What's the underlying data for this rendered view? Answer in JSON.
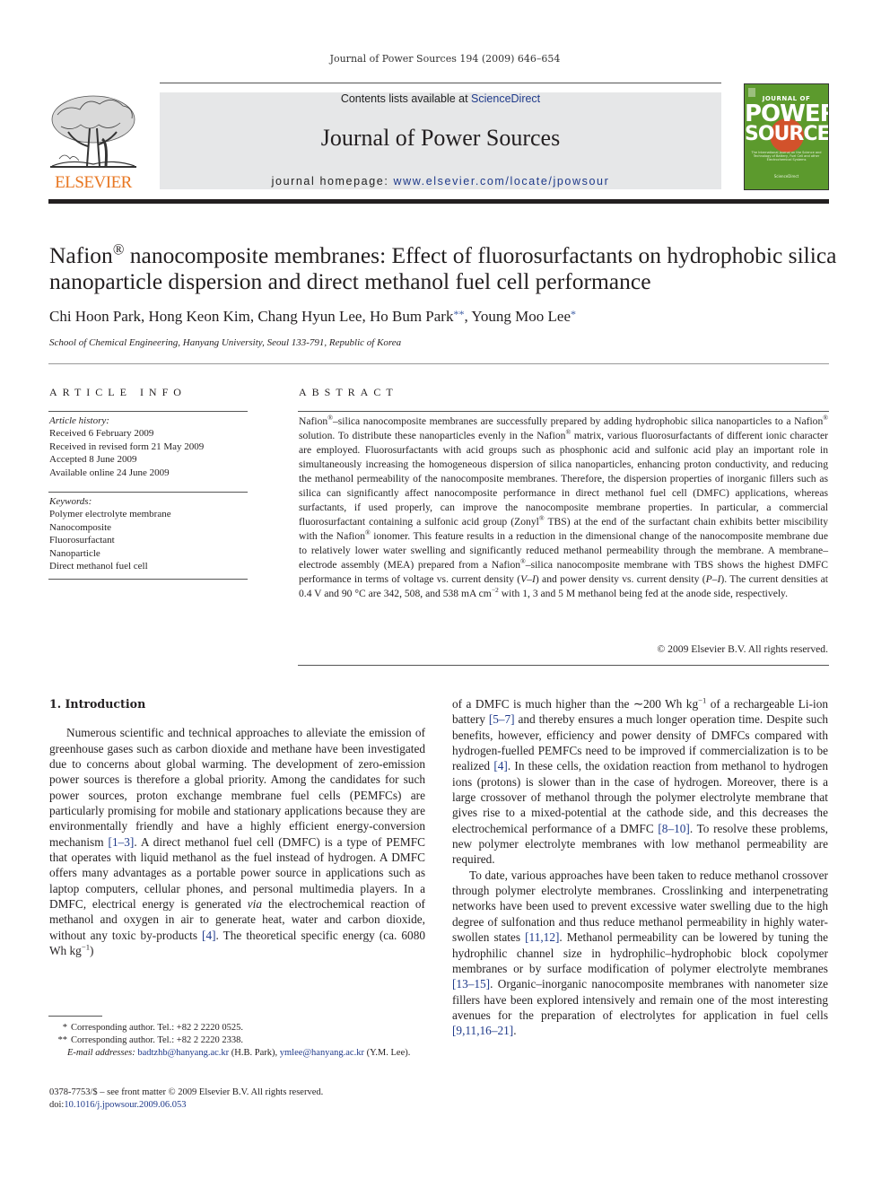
{
  "running_header": "Journal of Power Sources 194 (2009) 646–654",
  "masthead": {
    "publisher_logo_text": "ELSEVIER",
    "contents_prefix": "Contents lists available at ",
    "contents_link": "ScienceDirect",
    "journal_title": "Journal of Power Sources",
    "homepage_prefix": "journal homepage: ",
    "homepage_link": "www.elsevier.com/locate/jpowsour",
    "cover": {
      "line1": "JOURNAL OF",
      "line2": "POWER",
      "line3": "SOURCES",
      "subtitle": "The International Journal on the Science and Technology of Battery, Fuel Cell and other Electrochemical Systems",
      "publisher": "ScienceDirect"
    },
    "colors": {
      "elsevier_orange": "#e87722",
      "cover_green": "#5c9a2d",
      "cover_sun": "#d2522b",
      "link_blue": "#1f3a8a",
      "masthead_gray": "#e6e7e8"
    }
  },
  "article": {
    "title_part1": "Nafion",
    "title_reg": "®",
    "title_part2": " nanocomposite membranes: Effect of fluorosurfactants on hydrophobic silica nanoparticle dispersion and direct methanol fuel cell performance",
    "authors": [
      {
        "name": "Chi Hoon Park",
        "mark": ""
      },
      {
        "name": "Hong Keon Kim",
        "mark": ""
      },
      {
        "name": "Chang Hyun Lee",
        "mark": ""
      },
      {
        "name": "Ho Bum Park",
        "mark": "**"
      },
      {
        "name": "Young Moo Lee",
        "mark": "*"
      }
    ],
    "affiliation": "School of Chemical Engineering, Hanyang University, Seoul 133-791, Republic of Korea"
  },
  "article_info": {
    "heading": "ARTICLE INFO",
    "history_label": "Article history:",
    "history": [
      "Received 6 February 2009",
      "Received in revised form 21 May 2009",
      "Accepted 8 June 2009",
      "Available online 24 June 2009"
    ],
    "keywords_label": "Keywords:",
    "keywords": [
      "Polymer electrolyte membrane",
      "Nanocomposite",
      "Fluorosurfactant",
      "Nanoparticle",
      "Direct methanol fuel cell"
    ]
  },
  "abstract": {
    "heading": "ABSTRACT",
    "s1a": "Nafion",
    "s1b": "–silica nanocomposite membranes are successfully prepared by adding hydrophobic silica nanoparticles to a Nafion",
    "s1c": " solution. To distribute these nanoparticles evenly in the Nafion",
    "s1d": " matrix, various fluorosurfactants of different ionic character are employed. Fluorosurfactants with acid groups such as phosphonic acid and sulfonic acid play an important role in simultaneously increasing the homogeneous dispersion of silica nanoparticles, enhancing proton conductivity, and reducing the methanol permeability of the nanocomposite membranes. Therefore, the dispersion properties of inorganic fillers such as silica can significantly affect nanocomposite performance in direct methanol fuel cell (DMFC) applications, whereas surfactants, if used properly, can improve the nanocomposite membrane properties. In particular, a commercial fluorosurfactant containing a sulfonic acid group (Zonyl",
    "s1e": " TBS) at the end of the surfactant chain exhibits better miscibility with the Nafion",
    "s1f": " ionomer. This feature results in a reduction in the dimensional change of the nanocomposite membrane due to relatively lower water swelling and significantly reduced methanol permeability through the membrane. A membrane–electrode assembly (MEA) prepared from a Nafion",
    "s1g": "–silica nanocomposite membrane with TBS shows the highest DMFC performance in terms of voltage vs. current density (",
    "vi": "V–I",
    "s1h": ") and power density vs. current density (",
    "pi": "P–I",
    "s1i": "). The current densities at 0.4 V and 90 °C are 342, 508, and 538 mA cm",
    "exp": "−2",
    "s1j": " with 1, 3 and 5 M methanol being fed at the anode side, respectively.",
    "reg": "®",
    "copyright": "© 2009 Elsevier B.V. All rights reserved."
  },
  "introduction": {
    "heading": "1.  Introduction",
    "p1": [
      {
        "t": "Numerous scientific and technical approaches to alleviate the emission of greenhouse gases such as carbon dioxide and methane have been investigated due to concerns about global warming. The development of zero-emission power sources is therefore a global priority. Among the candidates for such power sources, proton exchange membrane fuel cells (PEMFCs) are particularly promising for mobile and stationary applications because they are environmentally friendly and have a highly efficient energy-conversion mechanism "
      },
      {
        "ref": "[1–3]"
      },
      {
        "t": ". A direct methanol fuel cell (DMFC) is a type of PEMFC that operates with liquid methanol as the fuel instead of hydrogen. A DMFC offers many advantages as a portable power source in applications such as laptop computers, cellular phones, and personal multimedia players. In a DMFC, electrical energy is generated "
      },
      {
        "i": "via"
      },
      {
        "t": " the electrochemical reaction of methanol and oxygen in air to generate heat, water and carbon dioxide, without any toxic by-products "
      },
      {
        "ref": "[4]"
      },
      {
        "t": ". The theoretical specific energy (ca. 6080 Wh kg"
      },
      {
        "sup": "−1"
      },
      {
        "t": ")"
      }
    ],
    "p1_cont": [
      {
        "t": "of a DMFC is much higher than the ∼200 Wh kg"
      },
      {
        "sup": "−1"
      },
      {
        "t": " of a rechargeable Li-ion battery "
      },
      {
        "ref": "[5–7]"
      },
      {
        "t": " and thereby ensures a much longer operation time. Despite such benefits, however, efficiency and power density of DMFCs compared with hydrogen-fuelled PEMFCs need to be improved if commercialization is to be realized "
      },
      {
        "ref": "[4]"
      },
      {
        "t": ". In these cells, the oxidation reaction from methanol to hydrogen ions (protons) is slower than in the case of hydrogen. Moreover, there is a large crossover of methanol through the polymer electrolyte membrane that gives rise to a mixed-potential at the cathode side, and this decreases the electrochemical performance of a DMFC "
      },
      {
        "ref": "[8–10]"
      },
      {
        "t": ". To resolve these problems, new polymer electrolyte membranes with low methanol permeability are required."
      }
    ],
    "p2": [
      {
        "t": "To date, various approaches have been taken to reduce methanol crossover through polymer electrolyte membranes. Crosslinking and interpenetrating networks have been used to prevent excessive water swelling due to the high degree of sulfonation and thus reduce methanol permeability in highly water-swollen states "
      },
      {
        "ref": "[11,12]"
      },
      {
        "t": ". Methanol permeability can be lowered by tuning the hydrophilic channel size in hydrophilic–hydrophobic block copolymer membranes or by surface modification of polymer electrolyte membranes "
      },
      {
        "ref": "[13–15]"
      },
      {
        "t": ". Organic–inorganic nanocomposite membranes with nanometer size fillers have been explored intensively and remain one of the most interesting avenues for the preparation of electrolytes for application in fuel cells "
      },
      {
        "ref": "[9,11,16–21]"
      },
      {
        "t": "."
      }
    ]
  },
  "footnotes": {
    "fn1_mark": "*",
    "fn1_text": "Corresponding author. Tel.: +82 2 2220 0525.",
    "fn2_mark": "**",
    "fn2_text": "Corresponding author. Tel.: +82 2 2220 2338.",
    "email_label": "E-mail addresses:",
    "email1": "badtzhb@hanyang.ac.kr",
    "email1_owner": " (H.B. Park), ",
    "email2": "ymlee@hanyang.ac.kr",
    "email2_owner": " (Y.M. Lee).",
    "front_matter": "0378-7753/$ – see front matter © 2009 Elsevier B.V. All rights reserved.",
    "doi_prefix": "doi:",
    "doi": "10.1016/j.jpowsour.2009.06.053"
  }
}
